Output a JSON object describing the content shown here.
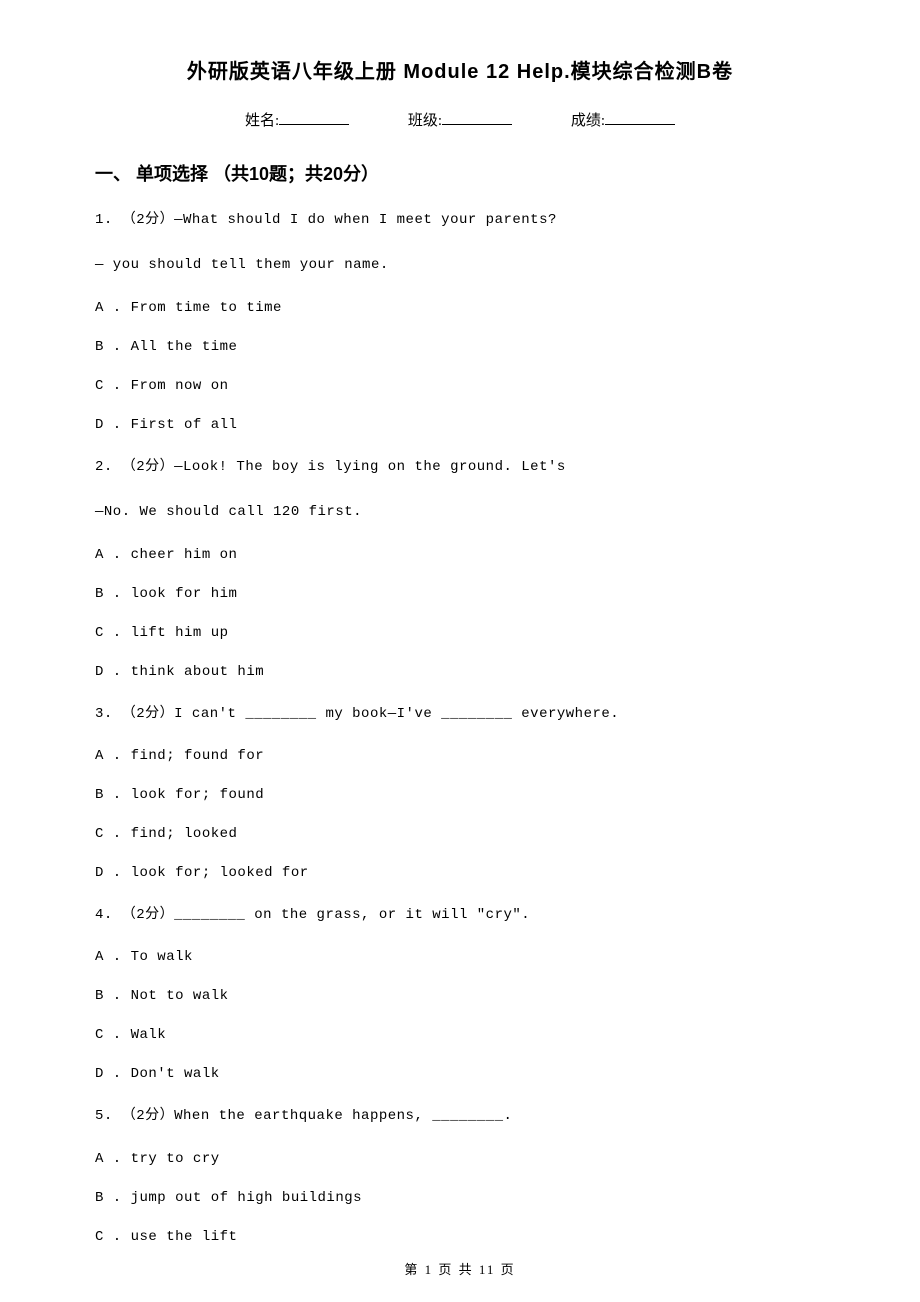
{
  "title": "外研版英语八年级上册 Module 12 Help.模块综合检测B卷",
  "info": {
    "nameLabel": "姓名:",
    "classLabel": "班级:",
    "scoreLabel": "成绩:"
  },
  "sectionHeader": "一、 单项选择 （共10题；共20分）",
  "questions": [
    {
      "num": "1.",
      "points": "（2分）",
      "text1": "—What should I do when I meet your parents?",
      "text2": "—              you should tell them your name.",
      "options": {
        "A": "A . From time to time",
        "B": "B . All the time",
        "C": "C . From now on",
        "D": "D . First of all"
      }
    },
    {
      "num": "2.",
      "points": "（2分）",
      "text1": "—Look! The boy is lying on the ground. Let's",
      "text2": "—No. We should call 120 first.",
      "options": {
        "A": "A . cheer him on",
        "B": "B . look for him",
        "C": "C . lift him up",
        "D": "D . think about him"
      }
    },
    {
      "num": "3.",
      "points": "（2分）",
      "text1": "I can't ________ my book—I've ________ everywhere.",
      "options": {
        "A": "A . find; found for",
        "B": "B . look for; found",
        "C": "C . find; looked",
        "D": "D . look for; looked for"
      }
    },
    {
      "num": "4.",
      "points": "（2分）",
      "text1": "________ on the grass, or it will \"cry\".",
      "options": {
        "A": "A . To walk",
        "B": "B . Not to walk",
        "C": "C . Walk",
        "D": "D . Don't walk"
      }
    },
    {
      "num": "5.",
      "points": "（2分）",
      "text1": "When the earthquake happens, ________.",
      "options": {
        "A": "A . try to cry",
        "B": "B . jump out of high buildings",
        "C": "C . use the lift"
      }
    }
  ],
  "footer": "第 1 页 共 11 页"
}
